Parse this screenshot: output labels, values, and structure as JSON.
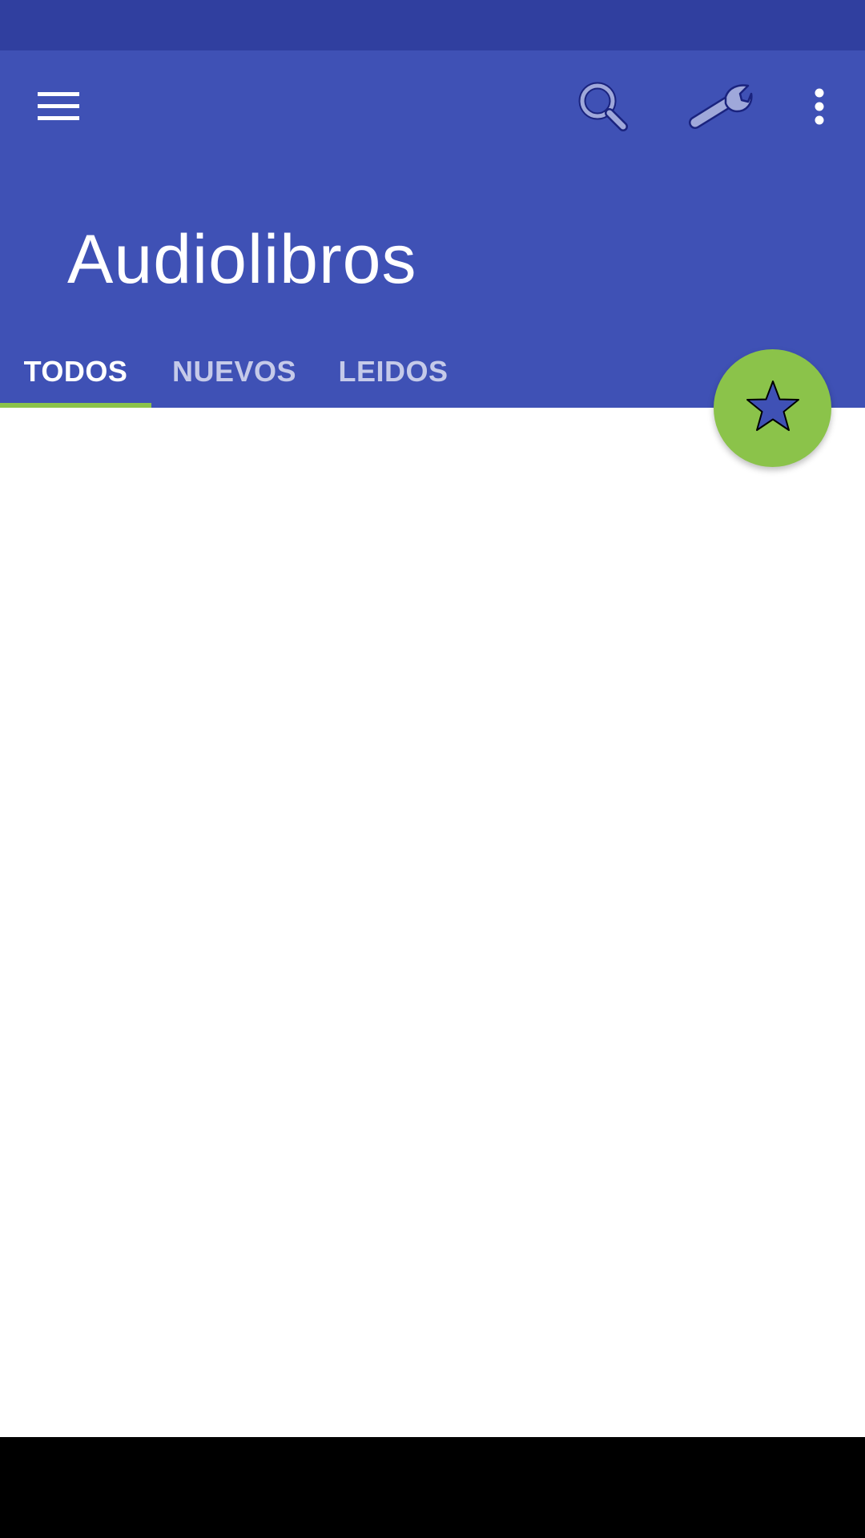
{
  "app": {
    "title": "Audiolibros"
  },
  "toolbar": {
    "menu_icon": "hamburger-menu-icon",
    "search_icon": "magnifier-icon",
    "settings_icon": "wrench-icon",
    "overflow_icon": "vertical-dots-icon"
  },
  "tabs": [
    {
      "label": "TODOS",
      "active": true
    },
    {
      "label": "NUEVOS",
      "active": false
    },
    {
      "label": "LEIDOS",
      "active": false
    }
  ],
  "fab": {
    "icon": "star-icon"
  },
  "colors": {
    "primary": "#3f51b5",
    "primary_dark": "#303f9f",
    "accent": "#8bc34a",
    "tab_inactive": "#c5cae9"
  }
}
